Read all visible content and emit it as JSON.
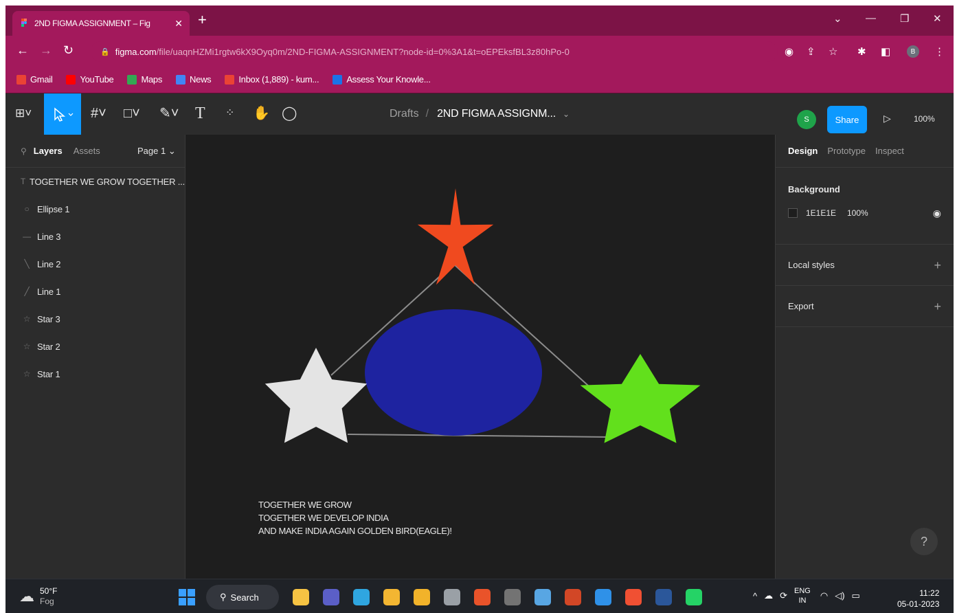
{
  "browser": {
    "tab_title": "2ND FIGMA ASSIGNMENT – Fig",
    "tab_close": "✕",
    "new_tab": "+",
    "url_host": "figma.com",
    "url_path": "/file/uaqnHZMi1rgtw6kX9Oyq0m/2ND-FIGMA-ASSIGNMENT?node-id=0%3A1&t=oEPEksfBL3z80hPo-0",
    "profile_letter": "B",
    "bookmarks": [
      {
        "label": "Gmail",
        "color": "#ea4335"
      },
      {
        "label": "YouTube",
        "color": "#ff0000"
      },
      {
        "label": "Maps",
        "color": "#34a853"
      },
      {
        "label": "News",
        "color": "#4285f4"
      },
      {
        "label": "Inbox (1,889) - kum...",
        "color": "#ea4335"
      },
      {
        "label": "Assess Your Knowle...",
        "color": "#1a73e8"
      }
    ]
  },
  "toolbar": {
    "breadcrumb_drafts": "Drafts",
    "breadcrumb_sep": "/",
    "file_name": "2ND FIGMA ASSIGNM...",
    "avatar_letter": "S",
    "share_label": "Share",
    "zoom": "100%"
  },
  "left_panel": {
    "tabs": {
      "layers": "Layers",
      "assets": "Assets",
      "page": "Page 1"
    },
    "layers": [
      {
        "icon": "text-icon",
        "glyph": "T",
        "name": "TOGETHER WE GROW TOGETHER ..."
      },
      {
        "icon": "ellipse-icon",
        "glyph": "○",
        "name": "Ellipse 1"
      },
      {
        "icon": "line-icon",
        "glyph": "—",
        "name": "Line 3"
      },
      {
        "icon": "line-icon",
        "glyph": "╲",
        "name": "Line 2"
      },
      {
        "icon": "line-icon",
        "glyph": "╱",
        "name": "Line 1"
      },
      {
        "icon": "star-icon",
        "glyph": "☆",
        "name": "Star 3"
      },
      {
        "icon": "star-icon",
        "glyph": "☆",
        "name": "Star 2"
      },
      {
        "icon": "star-icon",
        "glyph": "☆",
        "name": "Star 1"
      }
    ]
  },
  "canvas": {
    "background": "#1e1e1e",
    "colors": {
      "star_top": "#f04a1f",
      "star_left": "#e4e4e4",
      "star_right": "#62e01c",
      "ellipse": "#1e23a0",
      "lines": "#8c8c8c"
    },
    "poem": [
      "TOGETHER WE GROW",
      "TOGETHER WE DEVELOP INDIA",
      "AND MAKE INDIA AGAIN GOLDEN BIRD(EAGLE)!"
    ]
  },
  "right_panel": {
    "tabs": {
      "design": "Design",
      "prototype": "Prototype",
      "inspect": "Inspect"
    },
    "background_label": "Background",
    "background_hex": "1E1E1E",
    "background_opacity": "100%",
    "local_styles": "Local styles",
    "export": "Export",
    "help": "?"
  },
  "taskbar": {
    "temp": "50°F",
    "condition": "Fog",
    "search_label": "Search",
    "lang_top": "ENG",
    "lang_bottom": "IN",
    "time": "11:22",
    "date": "05-01-2023",
    "apps": [
      {
        "name": "file-explorer-icon",
        "color": "#f6c343"
      },
      {
        "name": "meet-icon",
        "color": "#5b5fc7"
      },
      {
        "name": "edge-icon",
        "color": "#2fa6e0"
      },
      {
        "name": "folder-icon",
        "color": "#f3b632"
      },
      {
        "name": "chrome-icon",
        "color": "#f2b32a"
      },
      {
        "name": "app-icon",
        "color": "#9aa0a6"
      },
      {
        "name": "office-icon",
        "color": "#e9532a"
      },
      {
        "name": "calculator-icon",
        "color": "#737373"
      },
      {
        "name": "notepad-icon",
        "color": "#58a6e3"
      },
      {
        "name": "powerpoint-icon",
        "color": "#d24726"
      },
      {
        "name": "vscode-icon",
        "color": "#2f91e8"
      },
      {
        "name": "git-icon",
        "color": "#f05033"
      },
      {
        "name": "word-icon",
        "color": "#2b579a"
      },
      {
        "name": "whatsapp-icon",
        "color": "#25d366"
      }
    ]
  }
}
